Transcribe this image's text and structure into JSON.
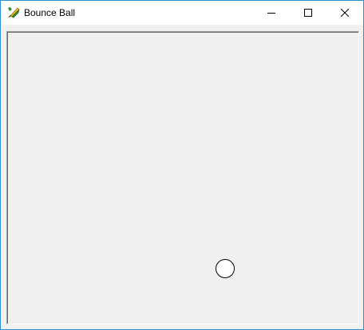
{
  "window": {
    "title": "Bounce Ball",
    "app_icon": "pencil-feather-icon",
    "border_color": "#2b8fd6"
  },
  "controls": {
    "minimize_icon": "minimize-icon",
    "maximize_icon": "maximize-icon",
    "close_icon": "close-icon"
  },
  "canvas": {
    "background_color": "#f0f0f0",
    "ball_color": "#ffffff",
    "ball_outline_color": "#000000"
  }
}
